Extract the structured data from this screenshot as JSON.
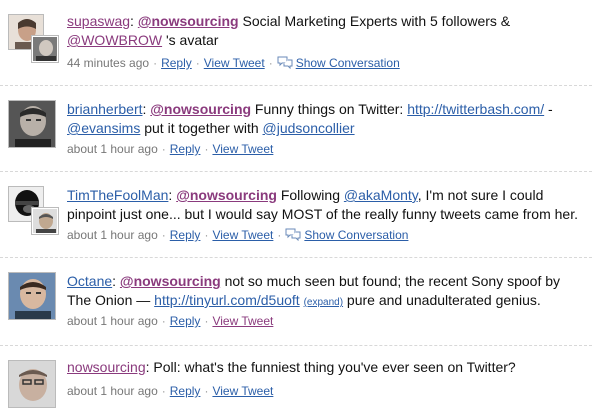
{
  "tweets": [
    {
      "user": "supaswag",
      "parts": {
        "m1": "@nowsourcing",
        "t1": " Social Marketing Experts with 5 followers &",
        "m2": "@WOWBROW",
        "t2": " 's avatar"
      },
      "time": "44 minutes ago",
      "reply": "Reply",
      "view": "View Tweet",
      "conv": "Show Conversation"
    },
    {
      "user": "brianherbert",
      "parts": {
        "sep": ": ",
        "m1": "@nowsourcing",
        "t1": " Funny things on Twitter: ",
        "link": "http://twitterbash.com/",
        "t2": " -",
        "m2": "@evansims",
        "t3": " put it together with ",
        "m3": "@judsoncollier"
      },
      "time": "about 1 hour ago",
      "reply": "Reply",
      "view": "View Tweet"
    },
    {
      "user": "TimTheFoolMan",
      "parts": {
        "sep": ": ",
        "m1": "@nowsourcing",
        "t1": " Following ",
        "m2": "@akaMonty",
        "t2": ", I'm not sure I could",
        "t3": "pinpoint just one... but I would say MOST of the really funny tweets came from her."
      },
      "time": "about 1 hour ago",
      "reply": "Reply",
      "view": "View Tweet",
      "conv": "Show Conversation"
    },
    {
      "user": "Octane",
      "parts": {
        "sep": ": ",
        "m1": "@nowsourcing",
        "t1": " not so much seen but found; the recent Sony spoof by",
        "t2": "The Onion — ",
        "link": "http://tinyurl.com/d5uoft",
        "expand": "(expand)",
        "t3": " pure and unadulterated genius."
      },
      "time": "about 1 hour ago",
      "reply": "Reply",
      "view": "View Tweet"
    },
    {
      "user": "nowsourcing",
      "parts": {
        "t1": ": Poll: what's the funniest thing you've ever seen on Twitter?"
      },
      "time": "about 1 hour ago",
      "reply": "Reply",
      "view": "View Tweet"
    }
  ],
  "colors": {
    "link": "#2b5ea8",
    "visited": "#8a3a7d",
    "meta": "#777777"
  }
}
